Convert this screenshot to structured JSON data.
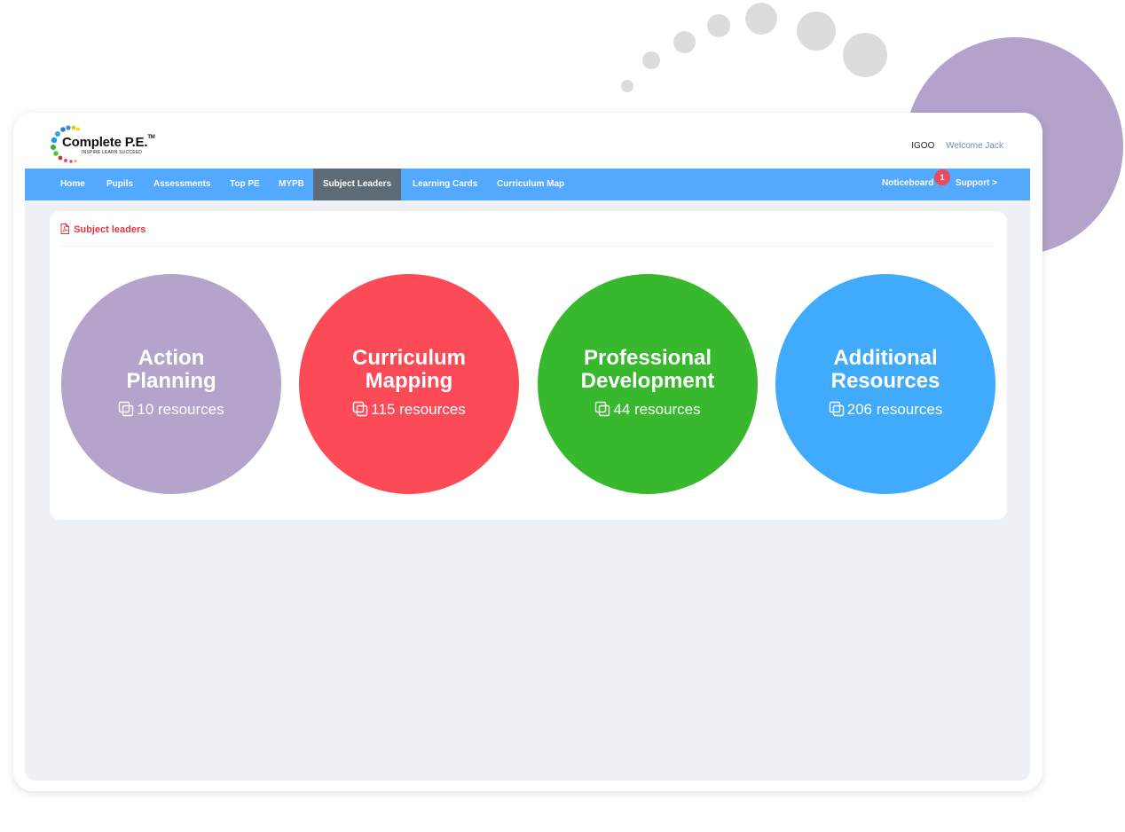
{
  "header": {
    "logo": {
      "name": "Complete P.E.",
      "tm": "TM",
      "tagline": "INSPIRE LEARN SUCCEED"
    },
    "school": "IGOO",
    "welcome": "Welcome Jack"
  },
  "nav": {
    "items": [
      {
        "label": "Home"
      },
      {
        "label": "Pupils"
      },
      {
        "label": "Assessments"
      },
      {
        "label": "Top PE"
      },
      {
        "label": "MYPB"
      },
      {
        "label": "Subject Leaders",
        "active": true
      },
      {
        "label": "Learning Cards"
      },
      {
        "label": "Curriculum Map"
      }
    ],
    "noticeboard": "Noticeboard",
    "noticeboard_badge": "1",
    "support": "Support >"
  },
  "page": {
    "title": "Subject leaders",
    "title_icon": "pdf-icon"
  },
  "categories": [
    {
      "title_line1": "Action",
      "title_line2": "Planning",
      "count": "10 resources",
      "color": "#b4a4cc",
      "icon": "copy-icon"
    },
    {
      "title_line1": "Curriculum",
      "title_line2": "Mapping",
      "count": "115 resources",
      "color": "#fd4a57",
      "icon": "copy-icon"
    },
    {
      "title_line1": "Professional",
      "title_line2": "Development",
      "count": "44 resources",
      "color": "#38b92d",
      "icon": "copy-icon"
    },
    {
      "title_line1": "Additional",
      "title_line2": "Resources",
      "count": "206 resources",
      "color": "#40abfc",
      "icon": "copy-icon"
    }
  ],
  "colors": {
    "navbar": "#52a9fd",
    "nav_active": "#5c6b76",
    "accent_red": "#e43545",
    "badge": "#ec4a5c"
  }
}
